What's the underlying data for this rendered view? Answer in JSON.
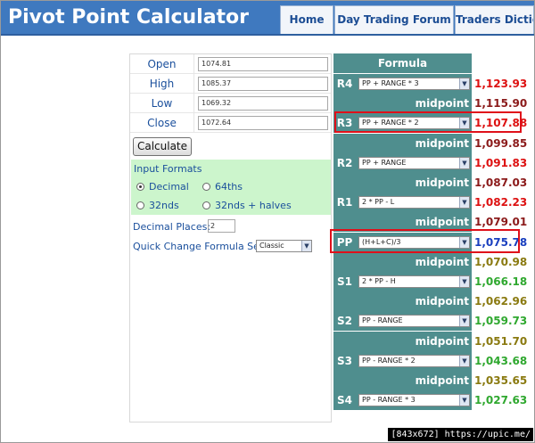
{
  "header": {
    "title": "Pivot Point Calculator",
    "tabs": [
      {
        "label": "Home"
      },
      {
        "label": "Day Trading Forum"
      },
      {
        "label": "Traders Dictio"
      }
    ]
  },
  "inputs": [
    {
      "label": "Open",
      "value": "1074.81"
    },
    {
      "label": "High",
      "value": "1085.37"
    },
    {
      "label": "Low",
      "value": "1069.32"
    },
    {
      "label": "Close",
      "value": "1072.64"
    }
  ],
  "calculate_label": "Calculate",
  "input_formats": {
    "title": "Input Formats",
    "options": [
      {
        "label": "Decimal",
        "selected": true
      },
      {
        "label": "64ths",
        "selected": false
      },
      {
        "label": "32nds",
        "selected": false
      },
      {
        "label": "32nds + halves",
        "selected": false
      }
    ]
  },
  "decimal_places": {
    "label": "Decimal Places:",
    "value": "2"
  },
  "quick_change": {
    "label": "Quick Change Formula Set:",
    "value": "Classic"
  },
  "formula_header": "Formula",
  "rows": [
    {
      "code": "R4",
      "formula": "PP + RANGE * 3",
      "value": "1,123.93",
      "color": "#dd1111"
    },
    {
      "midpoint": "midpoint",
      "value": "1,115.90",
      "color": "#8b1a1a"
    },
    {
      "code": "R3",
      "formula": "PP + RANGE * 2",
      "value": "1,107.88",
      "color": "#dd1111"
    },
    {
      "midpoint": "midpoint",
      "value": "1,099.85",
      "color": "#8b1a1a"
    },
    {
      "code": "R2",
      "formula": "PP + RANGE",
      "value": "1,091.83",
      "color": "#dd1111"
    },
    {
      "midpoint": "midpoint",
      "value": "1,087.03",
      "color": "#8b1a1a"
    },
    {
      "code": "R1",
      "formula": "2 * PP - L",
      "value": "1,082.23",
      "color": "#dd1111"
    },
    {
      "midpoint": "midpoint",
      "value": "1,079.01",
      "color": "#8b1a1a"
    },
    {
      "code": "PP",
      "formula": "(H+L+C)/3",
      "value": "1,075.78",
      "color": "#1a3fbf"
    },
    {
      "midpoint": "midpoint",
      "value": "1,070.98",
      "color": "#8a7a10"
    },
    {
      "code": "S1",
      "formula": "2 * PP - H",
      "value": "1,066.18",
      "color": "#2fa82f"
    },
    {
      "midpoint": "midpoint",
      "value": "1,062.96",
      "color": "#8a7a10"
    },
    {
      "code": "S2",
      "formula": "PP - RANGE",
      "value": "1,059.73",
      "color": "#2fa82f"
    },
    {
      "midpoint": "midpoint",
      "value": "1,051.70",
      "color": "#8a7a10"
    },
    {
      "code": "S3",
      "formula": "PP - RANGE * 2",
      "value": "1,043.68",
      "color": "#2fa82f"
    },
    {
      "midpoint": "midpoint",
      "value": "1,035.65",
      "color": "#8a7a10"
    },
    {
      "code": "S4",
      "formula": "PP - RANGE * 3",
      "value": "1,027.63",
      "color": "#2fa82f"
    }
  ],
  "watermark": "[843x672] https://upic.me/",
  "colors": {
    "header": "#3f79bf",
    "formula_cell": "#4f8e8e",
    "formats_bg": "#ccf5cc",
    "highlight": "#e0101a"
  }
}
